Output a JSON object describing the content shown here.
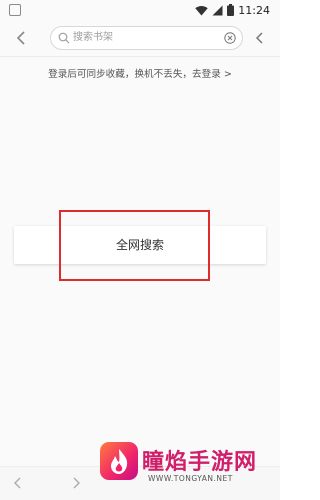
{
  "status_bar": {
    "time": "11:24",
    "icons": [
      "notification-icon",
      "wifi-icon",
      "signal-icon",
      "battery-icon"
    ]
  },
  "header": {
    "back_icon": "chevron-left-icon",
    "search": {
      "placeholder": "搜索书架",
      "value": ""
    },
    "clear_icon": "clear-icon",
    "more_icon": "chevron-left-icon"
  },
  "login_hint": "登录后可同步收藏，换机不丢失，去登录 >",
  "global_search_label": "全网搜索",
  "colors": {
    "highlight": "#e12a2a",
    "watermark_brand": "#d01e6a"
  },
  "watermark": {
    "title": "瞳焰手游网",
    "url": "WWW.TONGYAN.NET"
  }
}
